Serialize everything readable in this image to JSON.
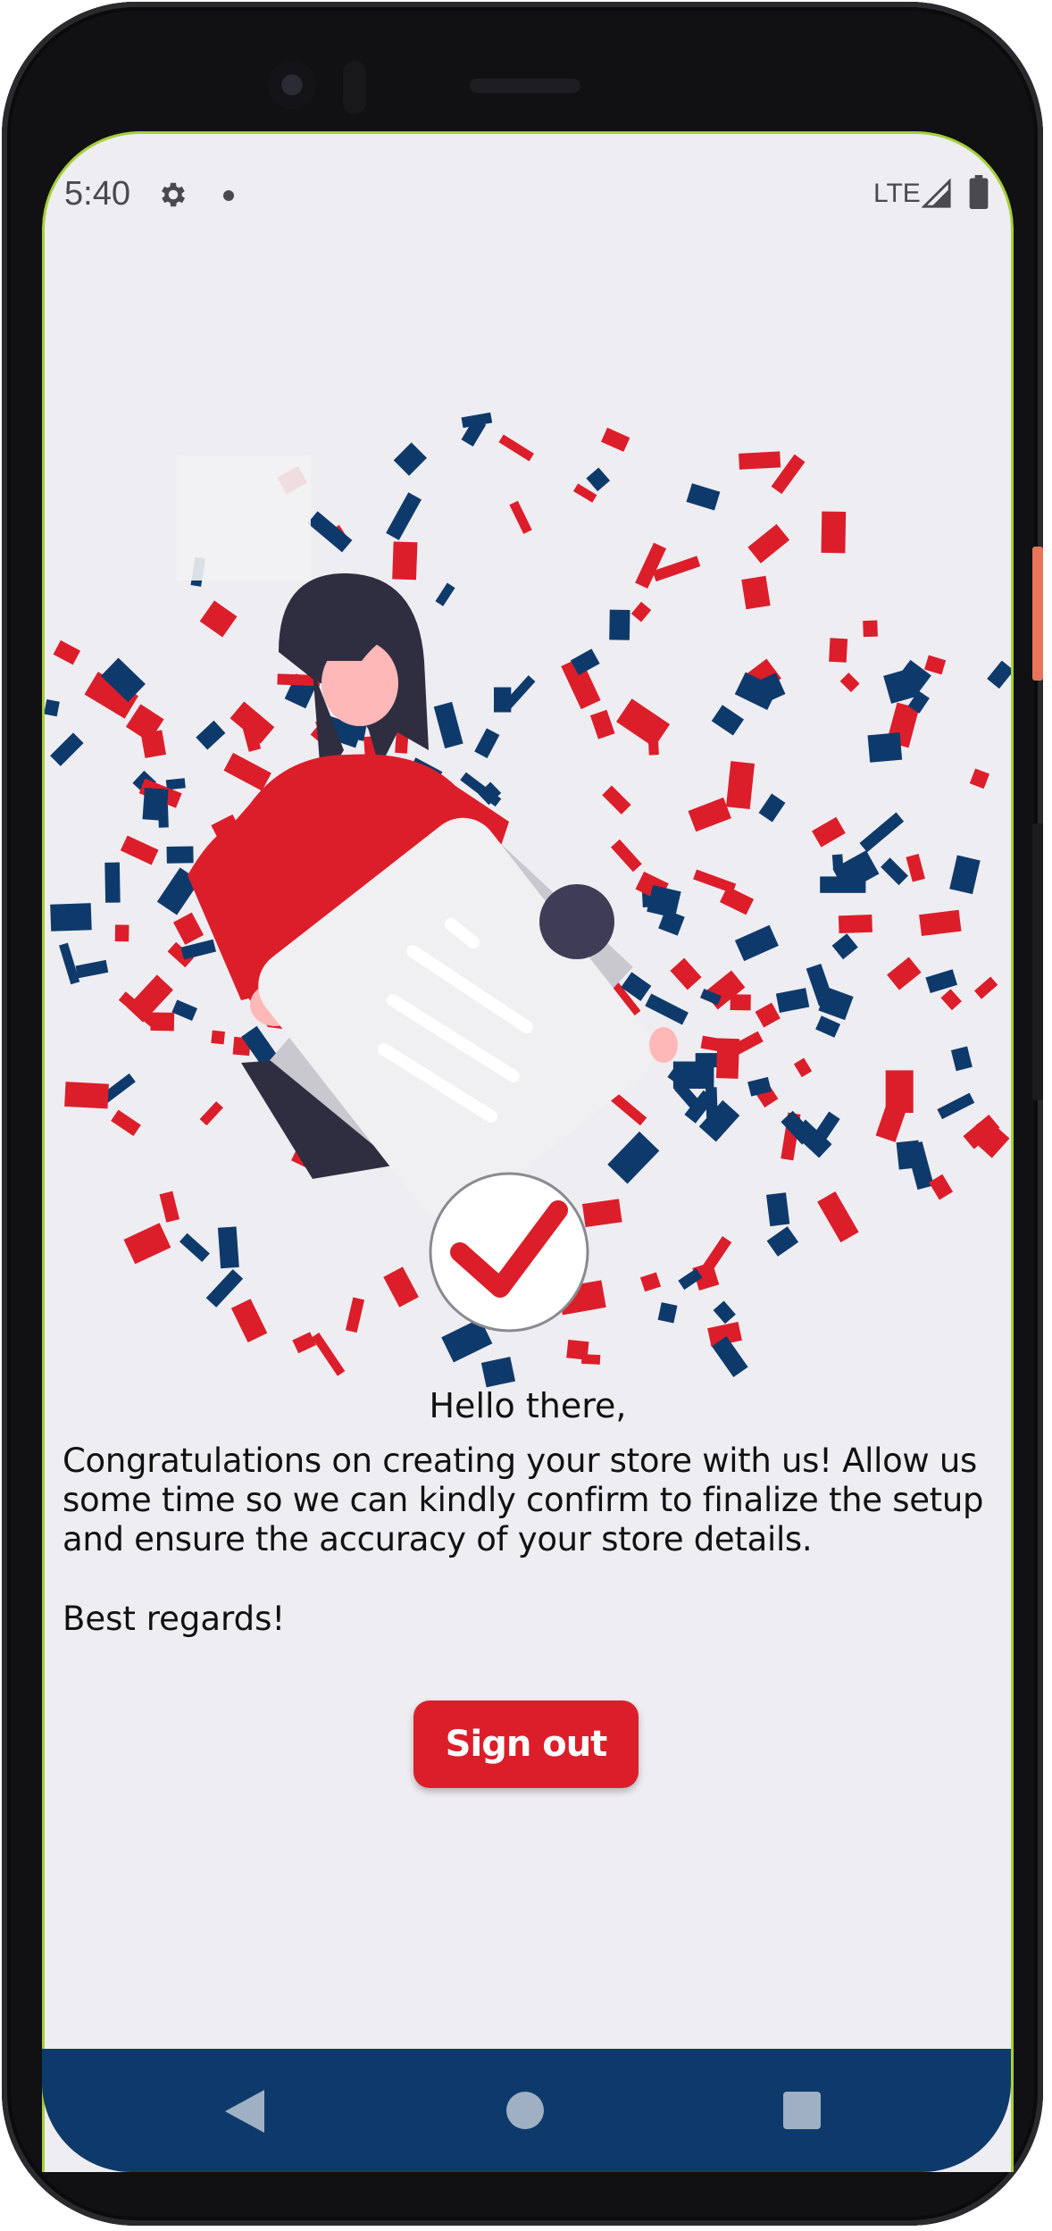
{
  "status_bar": {
    "time": "5:40",
    "network": "LTE",
    "icons": [
      "gear-icon",
      "notification-dot-icon",
      "signal-icon",
      "battery-icon"
    ]
  },
  "illustration": {
    "name": "confetti-celebration-illustration",
    "colors": {
      "red": "#dc1e2a",
      "navy": "#0e3a6b",
      "paper": "#f0eff2",
      "skin": "#ffb8b8",
      "hair": "#2f2e41"
    }
  },
  "content": {
    "greeting": "Hello there,",
    "message": "Congratulations on creating your store with us! Allow us some time so we can kindly confirm to finalize the setup and ensure the accuracy of your store details.",
    "regards": "Best regards!"
  },
  "actions": {
    "sign_out_label": "Sign out"
  },
  "nav_bar": {
    "icons": [
      "back-icon",
      "home-icon",
      "recents-icon"
    ]
  },
  "theme": {
    "accent": "#dc1e2a",
    "nav_bar": "#0e3a6b",
    "background": "#eeedf2"
  }
}
